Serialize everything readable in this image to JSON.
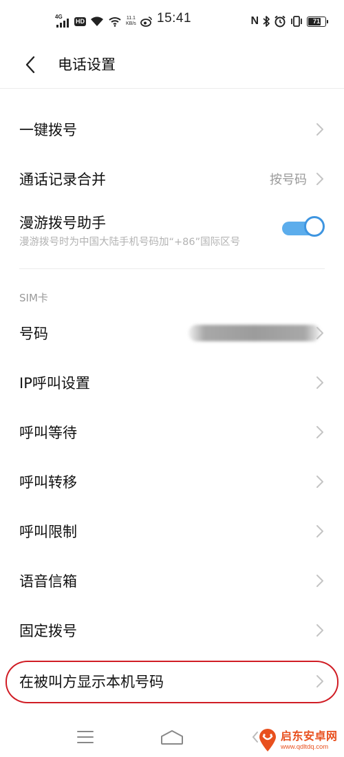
{
  "status_bar": {
    "network_type": "4G",
    "hd_badge": "HD",
    "net_speed_value": "11.1",
    "net_speed_unit": "KB/s",
    "time": "15:41",
    "nfc_label": "N",
    "battery_level": "71",
    "battery_fraction": 0.71
  },
  "header": {
    "title": "电话设置"
  },
  "rows_top": [
    {
      "label": "一键拨号"
    },
    {
      "label": "通话记录合并",
      "value": "按号码"
    }
  ],
  "roaming": {
    "title": "漫游拨号助手",
    "subtitle": "漫游拨号时为中国大陆手机号码加“+86”国际区号",
    "enabled": true,
    "accent_color": "#3e95e0"
  },
  "sim_section": {
    "title": "SIM卡",
    "items": [
      {
        "label": "号码"
      },
      {
        "label": "IP呼叫设置"
      },
      {
        "label": "呼叫等待"
      },
      {
        "label": "呼叫转移"
      },
      {
        "label": "呼叫限制"
      },
      {
        "label": "语音信箱"
      },
      {
        "label": "固定拨号"
      },
      {
        "label": "在被叫方显示本机号码"
      }
    ]
  },
  "highlight_color": "#d01c24",
  "watermark": {
    "name": "启东安卓网",
    "url": "www.qdltdq.com",
    "color": "#e8501e"
  }
}
